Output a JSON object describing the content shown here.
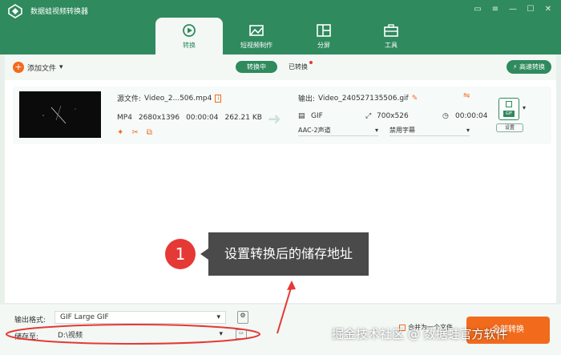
{
  "app": {
    "title": "数据蛙视频转换器"
  },
  "nav_tabs": [
    {
      "label": "转换",
      "icon": "convert-icon",
      "active": true
    },
    {
      "label": "短视频制作",
      "icon": "mv-icon",
      "active": false
    },
    {
      "label": "分屏",
      "icon": "split-screen-icon",
      "active": false
    },
    {
      "label": "工具",
      "icon": "toolbox-icon",
      "active": false
    }
  ],
  "toolbar": {
    "add_file": "添加文件",
    "converting_tab": "转换中",
    "converted_tab": "已转换",
    "fast_convert": "高速转换"
  },
  "file": {
    "source_label": "源文件:",
    "source_name": "Video_2...506.mp4",
    "format": "MP4",
    "resolution": "2680x1396",
    "duration": "00:00:04",
    "size": "262.21 KB",
    "output_label": "输出:",
    "output_name": "Video_240527135506.gif",
    "out_format": "GIF",
    "out_resolution": "700x526",
    "out_duration": "00:00:04",
    "audio_select": "AAC-2声道",
    "subtitle_select": "禁用字幕",
    "format_badge": "GIF",
    "settings": "设置"
  },
  "callout": {
    "number": "1",
    "text": "设置转换后的储存地址"
  },
  "bottom": {
    "output_format_label": "输出格式:",
    "output_format_value": "GIF Large GIF",
    "save_to_label": "储存至:",
    "save_to_value": "D:\\视频",
    "merge_label": "合并为一个文件",
    "convert_all": "全部转换"
  },
  "watermark": "掘金技术社区 @ 数据蛙官方软件",
  "colors": {
    "brand": "#2f8a5e",
    "accent": "#f26b1d",
    "highlight": "#e53935"
  }
}
